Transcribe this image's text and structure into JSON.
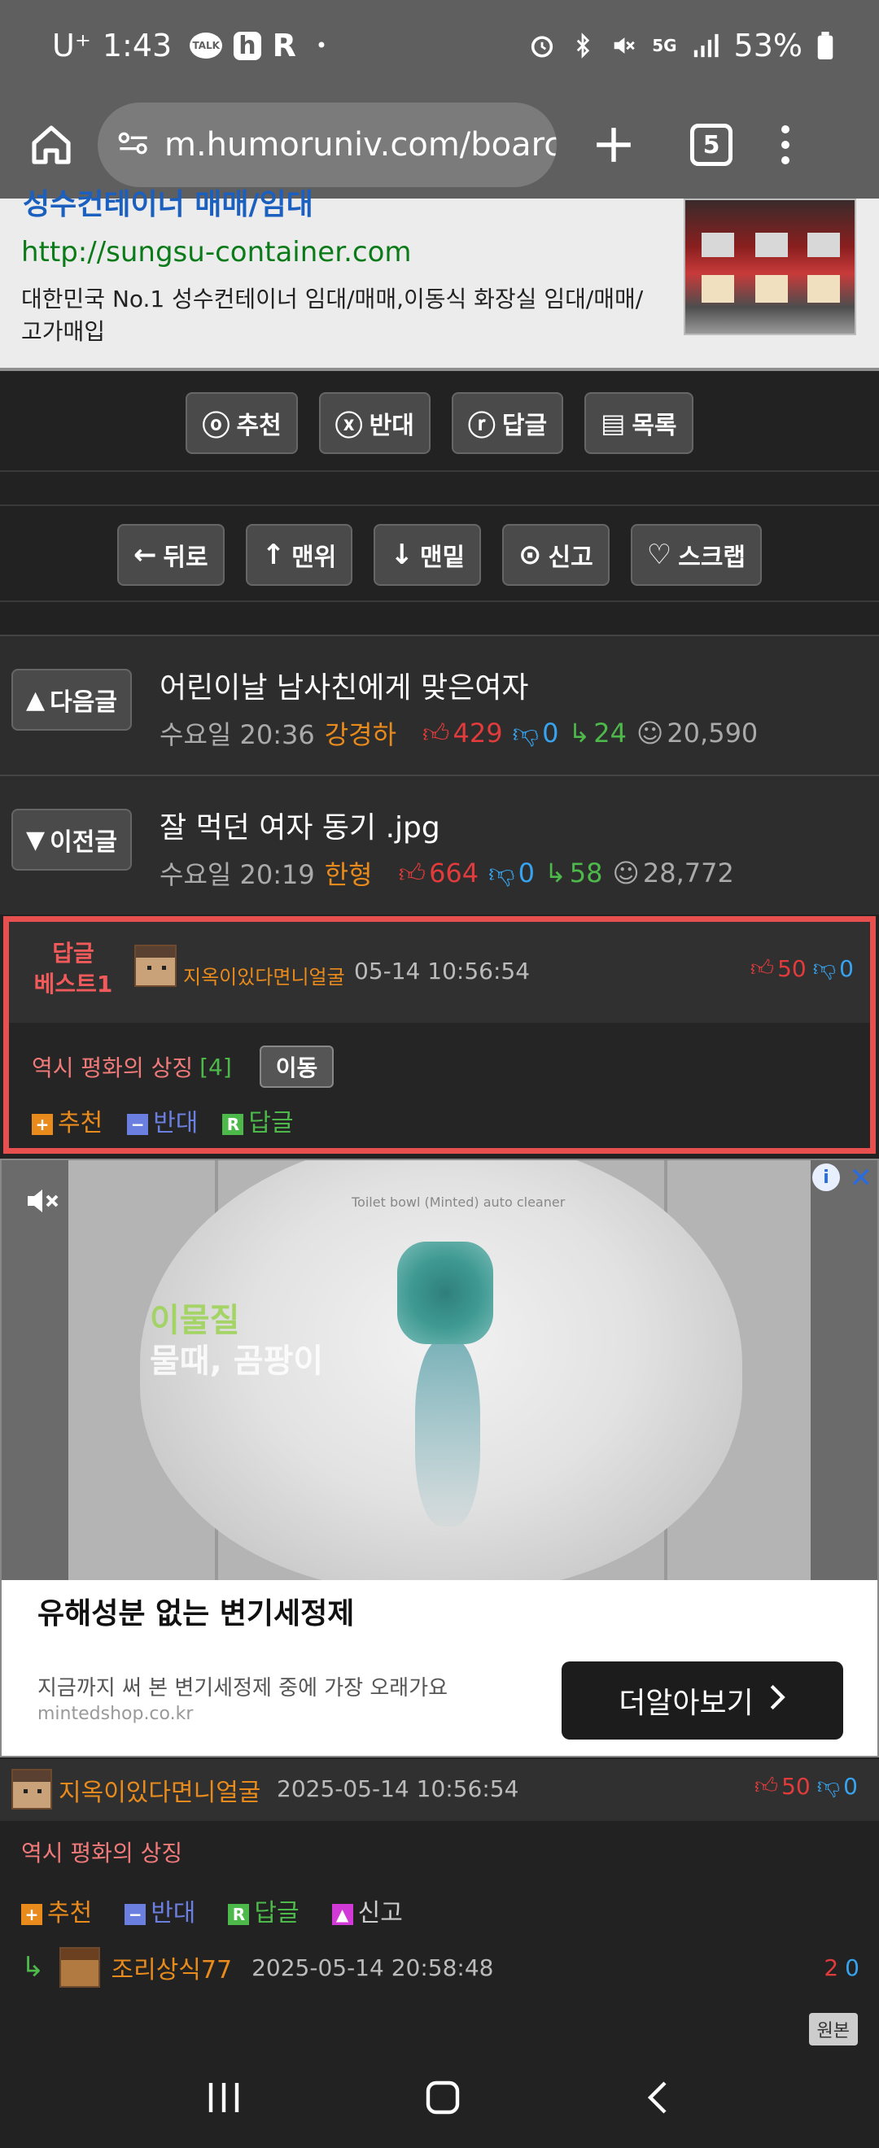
{
  "status_bar": {
    "carrier": "U⁺",
    "time": "1:43",
    "notif_talk": "TALK",
    "notif_h": "h",
    "notif_r": "R",
    "dot": "•",
    "battery": "53%"
  },
  "browser": {
    "url": "m.humoruniv.com/boarc",
    "tab_count": "5"
  },
  "banner": {
    "cut_title": "성수컨테이너 매매/임대",
    "link": "http://sungsu-container.com",
    "description": "대한민국 No.1 성수컨테이너 임대/매매,이동식 화장실 임대/매매/고가매입"
  },
  "action_row_1": [
    {
      "icon": "ⓞ",
      "label": "추천"
    },
    {
      "icon": "ⓧ",
      "label": "반대"
    },
    {
      "icon": "ⓡ",
      "label": "답글"
    },
    {
      "icon": "▤",
      "label": "목록"
    }
  ],
  "action_row_2": [
    {
      "icon": "←",
      "label": "뒤로"
    },
    {
      "icon": "↑",
      "label": "맨위"
    },
    {
      "icon": "↓",
      "label": "맨밑"
    },
    {
      "icon": "⊙",
      "label": "신고"
    },
    {
      "icon": "♡",
      "label": "스크랩"
    }
  ],
  "next_post": {
    "button": "다음글",
    "title": "어린이날 남사친에게 맞은여자",
    "time": "수요일 20:36",
    "author": "강경하",
    "up": "429",
    "down": "0",
    "replies": "24",
    "views": "20,590"
  },
  "prev_post": {
    "button": "이전글",
    "title": "잘 먹던 여자 동기 .jpg",
    "time": "수요일 20:19",
    "author": "한형",
    "up": "664",
    "down": "0",
    "replies": "58",
    "views": "28,772"
  },
  "best_reply": {
    "tag_line1": "답글",
    "tag_line2": "베스트1",
    "nickname": "지옥이있다면니얼굴",
    "date": "05-14 10:56:54",
    "up": "50",
    "down": "0",
    "content": "역시 평화의 상징",
    "reply_count": "[4]",
    "move_label": "이동",
    "action_recommend": "추천",
    "action_oppose": "반대",
    "action_reply": "답글"
  },
  "ad": {
    "brand_text": "Toilet bowl  (Minted)  auto cleaner",
    "overlay_line1": "이물질",
    "overlay_line2": "물때, 곰팡이",
    "title": "유해성분 없는 변기세정제",
    "description": "지금까지 써 본 변기세정제 중에 가장 오래가요",
    "domain": "mintedshop.co.kr",
    "cta": "더알아보기",
    "info": "i",
    "close": "✕"
  },
  "comment": {
    "nickname": "지옥이있다면니얼굴",
    "date": "2025-05-14 10:56:54",
    "up": "50",
    "down": "0",
    "content": "역시 평화의 상징",
    "action_recommend": "추천",
    "action_oppose": "반대",
    "action_reply": "답글",
    "action_report": "신고"
  },
  "reply": {
    "nickname": "조리상식77",
    "date": "2025-05-14 20:58:48",
    "up": "2",
    "down": "0"
  },
  "origin_label": "원본",
  "colors": {
    "orange": "#e98b1c",
    "red": "#e23b3b",
    "blue": "#37a3ee",
    "green": "#4db94b",
    "best_border": "#e85050"
  }
}
